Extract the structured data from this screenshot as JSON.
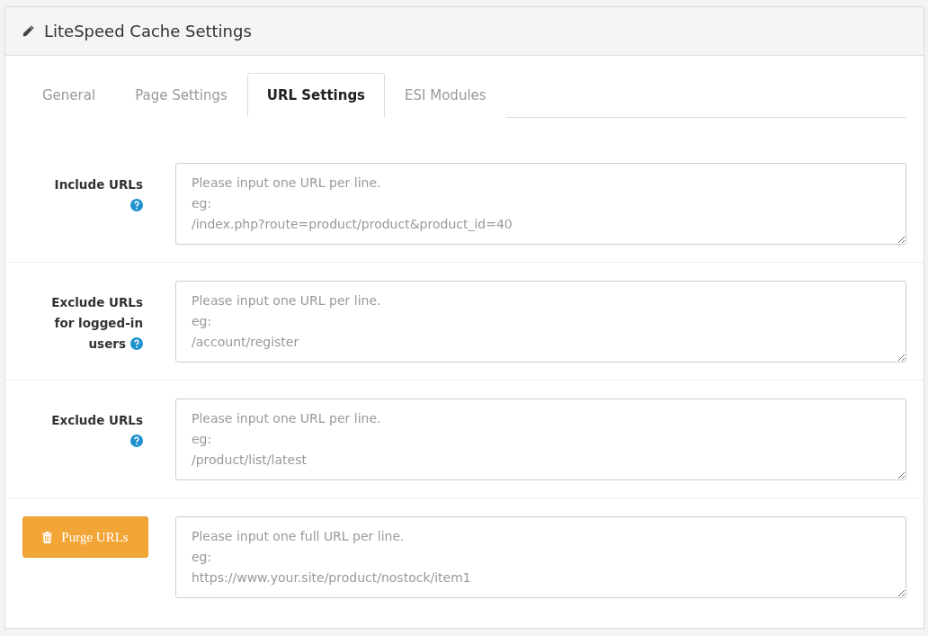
{
  "panel": {
    "title": "LiteSpeed Cache Settings"
  },
  "tabs": [
    {
      "label": "General",
      "selected": false
    },
    {
      "label": "Page Settings",
      "selected": false
    },
    {
      "label": "URL Settings",
      "selected": true
    },
    {
      "label": "ESI Modules",
      "selected": false
    }
  ],
  "rows": [
    {
      "kind": "field",
      "label": "Include URLs",
      "help": true,
      "placeholder": "Please input one URL per line.\neg:\n/index.php?route=product/product&product_id=40"
    },
    {
      "kind": "field",
      "label": "Exclude URLs for logged-in users",
      "help": true,
      "placeholder": "Please input one URL per line.\neg:\n/account/register"
    },
    {
      "kind": "field",
      "label": "Exclude URLs",
      "help": true,
      "placeholder": "Please input one URL per line.\neg:\n/product/list/latest"
    },
    {
      "kind": "button",
      "label": "Purge URLs",
      "placeholder": "Please input one full URL per line.\neg:\nhttps://www.your.site/product/nostock/item1"
    }
  ]
}
